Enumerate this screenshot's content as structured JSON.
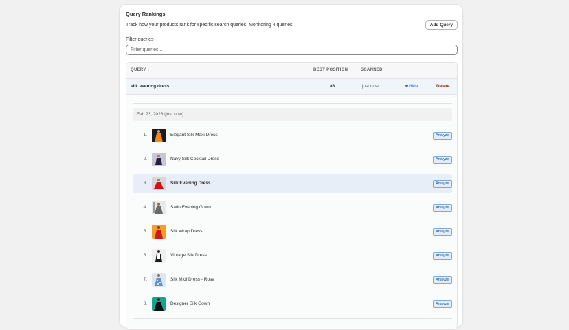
{
  "header": {
    "title": "Query Rankings",
    "subtitle": "Track how your products rank for specific search queries. Monitoring 4 queries.",
    "add_button": "Add Query"
  },
  "filter": {
    "label": "Filter queries",
    "placeholder": "Filter queries..."
  },
  "table": {
    "columns": {
      "query": "QUERY",
      "best_position": "BEST POSITION",
      "scanned": "SCANNED"
    },
    "sort_glyph": "↕",
    "query_row": {
      "name": "silk evening dress",
      "best_position": "#3",
      "scanned": "just now",
      "hide_label": "Hide",
      "delete_label": "Delete"
    }
  },
  "expanded": {
    "scan_date": "Feb 23, 2026 (just now)",
    "analyze_label": "Analyze",
    "results": [
      {
        "rank": "1.",
        "name": "Elegant Silk Maxi Dress",
        "highlight": false,
        "thumb": "orange-dress"
      },
      {
        "rank": "2.",
        "name": "Navy Silk Cocktail Dress",
        "highlight": false,
        "thumb": "navy-dress"
      },
      {
        "rank": "3.",
        "name": "Silk Evening Dress",
        "highlight": true,
        "thumb": "red-dress"
      },
      {
        "rank": "4.",
        "name": "Satin Evening Gown",
        "highlight": false,
        "thumb": "gray-gown"
      },
      {
        "rank": "5.",
        "name": "Silk Wrap Dress",
        "highlight": false,
        "thumb": "red-wrap-dress"
      },
      {
        "rank": "6.",
        "name": "Vintage Silk Dress",
        "highlight": false,
        "thumb": "black-white-dress"
      },
      {
        "rank": "7.",
        "name": "Silk Midi Dress - Rose",
        "highlight": false,
        "thumb": "blue-pattern-dress"
      },
      {
        "rank": "8.",
        "name": "Designer Silk Gown",
        "highlight": false,
        "thumb": "teal-gown"
      }
    ]
  },
  "colors": {
    "link": "#2c6ecb",
    "delete": "#8e1f0b",
    "highlight_row": "#e7eef8",
    "query_row_bg": "#f0f5fb"
  }
}
